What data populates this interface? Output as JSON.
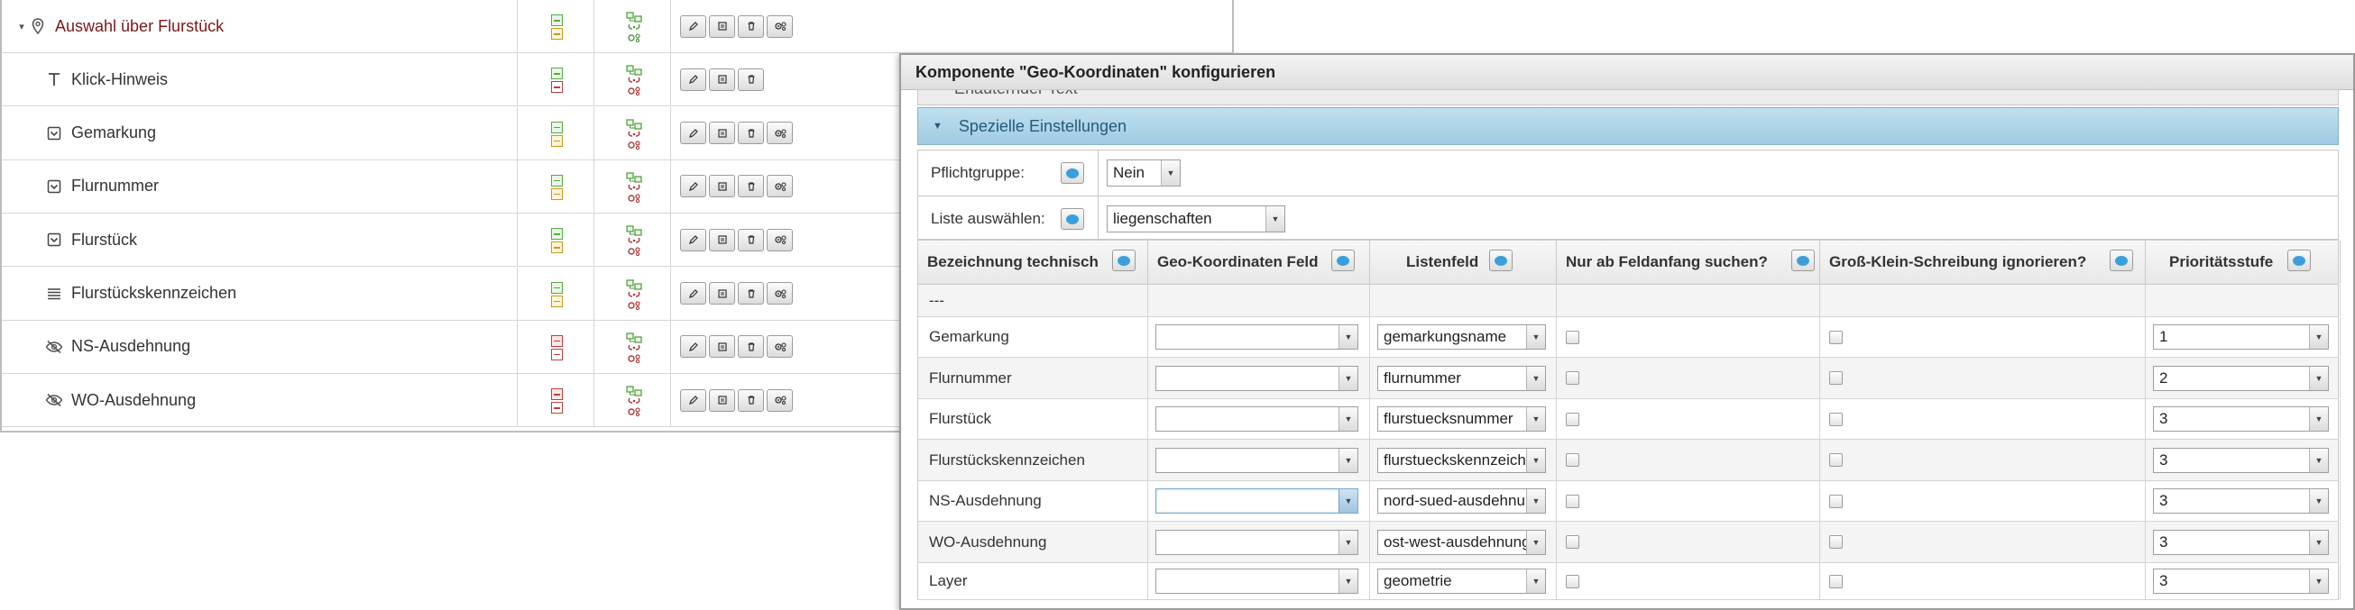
{
  "tree": {
    "rows": [
      {
        "label": "Auswahl über Flurstück",
        "root": true,
        "type_icon": "location-pin-icon",
        "status": "green-yellow",
        "actions": 4
      },
      {
        "label": "Klick-Hinweis",
        "type_icon": "text-type-icon",
        "status": "green-red",
        "actions": 3
      },
      {
        "label": "Gemarkung",
        "type_icon": "dropdown-type-icon",
        "status": "green-yellow",
        "actions": 4
      },
      {
        "label": "Flurnummer",
        "type_icon": "dropdown-type-icon",
        "status": "green-yellow",
        "actions": 4
      },
      {
        "label": "Flurstück",
        "type_icon": "dropdown-type-icon",
        "status": "green-yellow",
        "actions": 4
      },
      {
        "label": "Flurstückskennzeichen",
        "type_icon": "list-lines-icon",
        "status": "green-yellow",
        "actions": 4
      },
      {
        "label": "NS-Ausdehnung",
        "type_icon": "hidden-eye-icon",
        "status": "red-red",
        "actions": 4
      },
      {
        "label": "WO-Ausdehnung",
        "type_icon": "hidden-eye-icon",
        "status": "red-red",
        "actions": 4
      }
    ],
    "action_icons": [
      "pencil-icon",
      "copy-icon",
      "trash-icon",
      "gears-icon"
    ]
  },
  "dialog": {
    "title": "Komponente \"Geo-Koordinaten\" konfigurieren",
    "collapsed_section": "Erläuternder Text",
    "open_section": "Spezielle Einstellungen",
    "settings": {
      "pflichtgruppe_label": "Pflichtgruppe:",
      "pflichtgruppe_value": "Nein",
      "liste_label": "Liste auswählen:",
      "liste_value": "liegenschaften"
    },
    "columns": [
      "Bezeichnung technisch",
      "Geo-Koordinaten Feld",
      "Listenfeld",
      "Nur ab Feldanfang suchen?",
      "Groß-Klein-Schreibung ignorieren?",
      "Prioritätsstufe"
    ],
    "rows": [
      {
        "name": "---",
        "geo": "",
        "listenfeld": "",
        "prio": "",
        "empty": true
      },
      {
        "name": "Gemarkung",
        "geo": "",
        "listenfeld": "gemarkungsname",
        "prio": "1"
      },
      {
        "name": "Flurnummer",
        "geo": "",
        "listenfeld": "flurnummer",
        "prio": "2"
      },
      {
        "name": "Flurstück",
        "geo": "",
        "listenfeld": "flurstuecksnummer",
        "prio": "3"
      },
      {
        "name": "Flurstückskennzeichen",
        "geo": "",
        "listenfeld": "flurstueckskennzeichen",
        "prio": "3"
      },
      {
        "name": "NS-Ausdehnung",
        "geo": "",
        "listenfeld": "nord-sued-ausdehnung",
        "prio": "3",
        "geo_active": true
      },
      {
        "name": "WO-Ausdehnung",
        "geo": "",
        "listenfeld": "ost-west-ausdehnung",
        "prio": "3"
      },
      {
        "name": "Layer",
        "geo": "",
        "listenfeld": "geometrie",
        "prio": "3"
      }
    ]
  },
  "colors": {
    "root_label": "#7a1818",
    "accordion_blue": "#9fcbe3",
    "help_blue": "#3aa0dd"
  }
}
